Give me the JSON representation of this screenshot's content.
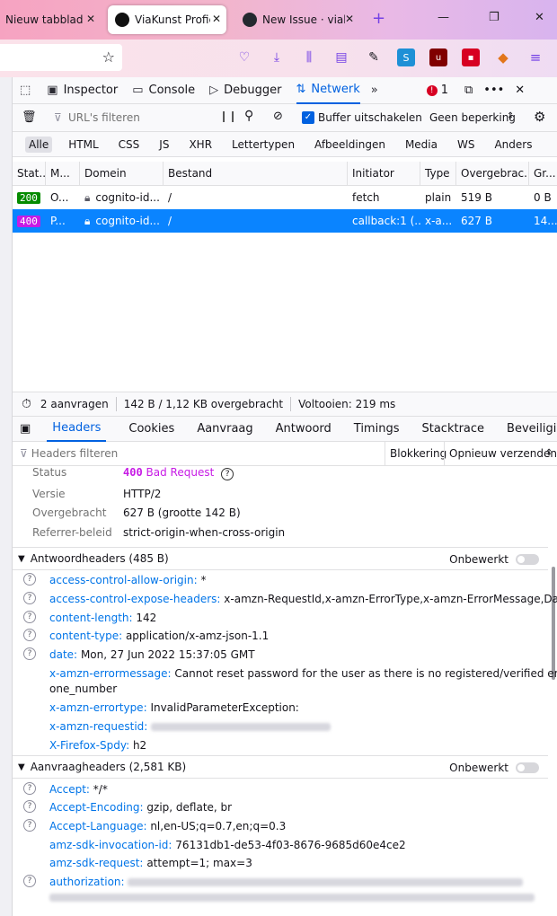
{
  "browser": {
    "tabs": [
      {
        "title": "Nieuw tabblad"
      },
      {
        "title": "ViaKunst Profiel |"
      },
      {
        "title": "New Issue · viak"
      }
    ],
    "new_tab": "+"
  },
  "toolbar": {
    "inspector": "Inspector",
    "console": "Console",
    "debugger": "Debugger",
    "network": "Netwerk",
    "error_count": "1"
  },
  "filter": {
    "url_placeholder": "URL's filteren",
    "disable_cache": "Buffer uitschakelen",
    "throttle": "Geen beperking"
  },
  "types": [
    "Alle",
    "HTML",
    "CSS",
    "JS",
    "XHR",
    "Lettertypen",
    "Afbeeldingen",
    "Media",
    "WS",
    "Anders"
  ],
  "table": {
    "headers": [
      "Stat...",
      "M...",
      "Domein",
      "Bestand",
      "Initiator",
      "Type",
      "Overgebrac...",
      "Gr..."
    ],
    "rows": [
      {
        "status": "200",
        "method": "O...",
        "domain": "cognito-id...",
        "file": "/",
        "initiator": "fetch",
        "type": "plain",
        "transferred": "519 B",
        "size": "0 B"
      },
      {
        "status": "400",
        "method": "P...",
        "domain": "cognito-id...",
        "file": "/",
        "initiator": "callback:1 (...",
        "type": "x-a...",
        "transferred": "627 B",
        "size": "14..."
      }
    ]
  },
  "summary": {
    "requests": "2 aanvragen",
    "bytes": "142 B / 1,12 KB overgebracht",
    "finished": "Voltooien: 219 ms"
  },
  "detail_tabs": [
    "Headers",
    "Cookies",
    "Aanvraag",
    "Antwoord",
    "Timings",
    "Stacktrace",
    "Beveiliging"
  ],
  "headers_filter": {
    "placeholder": "Headers filteren",
    "block": "Blokkering",
    "resend": "Opnieuw verzenden"
  },
  "status_block": {
    "status_label": "Status",
    "status_code": "400",
    "status_text": "Bad Request",
    "version_label": "Versie",
    "version": "HTTP/2",
    "transferred_label": "Overgebracht",
    "transferred": "627 B (grootte 142 B)",
    "referrer_label": "Referrer-beleid",
    "referrer": "strict-origin-when-cross-origin"
  },
  "response_headers": {
    "title": "Antwoordheaders (485 B)",
    "raw": "Onbewerkt",
    "items": [
      {
        "name": "access-control-allow-origin:",
        "value": "*"
      },
      {
        "name": "access-control-expose-headers:",
        "value": "x-amzn-RequestId,x-amzn-ErrorType,x-amzn-ErrorMessage,Date"
      },
      {
        "name": "content-length:",
        "value": "142"
      },
      {
        "name": "content-type:",
        "value": "application/x-amz-json-1.1"
      },
      {
        "name": "date:",
        "value": "Mon, 27 Jun 2022 15:37:05 GMT"
      },
      {
        "name": "x-amzn-errormessage:",
        "value": "Cannot reset password for the user as there is no registered/verified email or ph",
        "value2": "one_number"
      },
      {
        "name": "x-amzn-errortype:",
        "value": "InvalidParameterException:"
      },
      {
        "name": "x-amzn-requestid:",
        "value": ""
      },
      {
        "name": "X-Firefox-Spdy:",
        "value": "h2"
      }
    ]
  },
  "request_headers": {
    "title": "Aanvraagheaders (2,581 KB)",
    "raw": "Onbewerkt",
    "items": [
      {
        "name": "Accept:",
        "value": "*/*"
      },
      {
        "name": "Accept-Encoding:",
        "value": "gzip, deflate, br"
      },
      {
        "name": "Accept-Language:",
        "value": "nl,en-US;q=0.7,en;q=0.3"
      },
      {
        "name": "amz-sdk-invocation-id:",
        "value": "76131db1-de53-4f03-8676-9685d60e4ce2"
      },
      {
        "name": "amz-sdk-request:",
        "value": "attempt=1; max=3"
      },
      {
        "name": "authorization:",
        "value": ""
      }
    ]
  },
  "colors": {
    "accent": "#0061e0",
    "selected_row": "#0a84ff",
    "status_200": "#058b00",
    "status_400": "#c71be5"
  }
}
